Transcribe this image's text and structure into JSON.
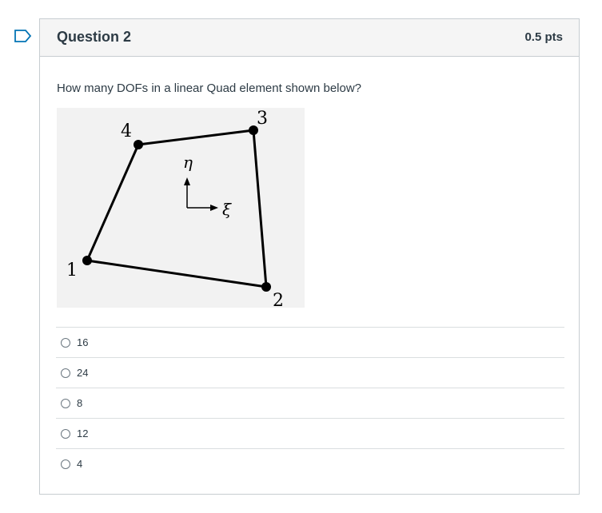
{
  "question": {
    "title": "Question 2",
    "points": "0.5 pts",
    "text": "How many DOFs in a linear Quad element shown below?"
  },
  "figure": {
    "node_labels": [
      "1",
      "2",
      "3",
      "4"
    ],
    "axis_labels": {
      "eta": "η",
      "xi": "ξ"
    }
  },
  "answers": [
    {
      "label": "16"
    },
    {
      "label": "24"
    },
    {
      "label": "8"
    },
    {
      "label": "12"
    },
    {
      "label": "4"
    }
  ],
  "colors": {
    "flag_accent": "#0374b5",
    "header_bg": "#f5f5f5",
    "border": "#c7cdd1",
    "text": "#2d3b45"
  }
}
